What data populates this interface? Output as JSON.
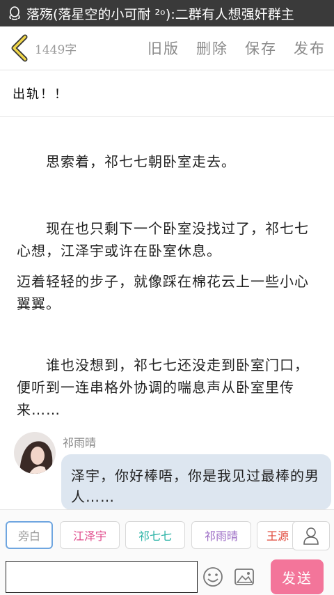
{
  "notification": {
    "icon": "qq-icon",
    "text": "落殇(落星空的小可耐 ²ᵒ):二群有人想强奸群主"
  },
  "header": {
    "back_icon": "chevron-left-icon",
    "word_count": "1449字",
    "actions": [
      "旧版",
      "删除",
      "保存",
      "发布"
    ]
  },
  "chapter": {
    "title": "出轨！！"
  },
  "paragraphs": [
    "　　思索着，祁七七朝卧室走去。",
    "　　现在也只剩下一个卧室没找过了，祁七七心想，江泽宇或许在卧室休息。",
    "迈着轻轻的步子，就像踩在棉花云上一些小心翼翼。",
    "　　谁也没想到，祁七七还没走到卧室门口，便听到一连串格外协调的喘息声从卧室里传来……"
  ],
  "dialogue": {
    "speaker": "祁雨晴",
    "text": "泽宇，你好棒唔，你是我见过最棒的男人……"
  },
  "characters": [
    {
      "label": "旁白",
      "color": "#999999",
      "selected": true
    },
    {
      "label": "江泽宇",
      "color": "#e0488a",
      "selected": false
    },
    {
      "label": "祁七七",
      "color": "#2bb3a6",
      "selected": false
    },
    {
      "label": "祁雨晴",
      "color": "#9b6bc4",
      "selected": false
    },
    {
      "label": "王源",
      "color": "#e0483a",
      "selected": false
    }
  ],
  "composer": {
    "input_value": "",
    "send_label": "发送",
    "accent": "#f3759a"
  }
}
